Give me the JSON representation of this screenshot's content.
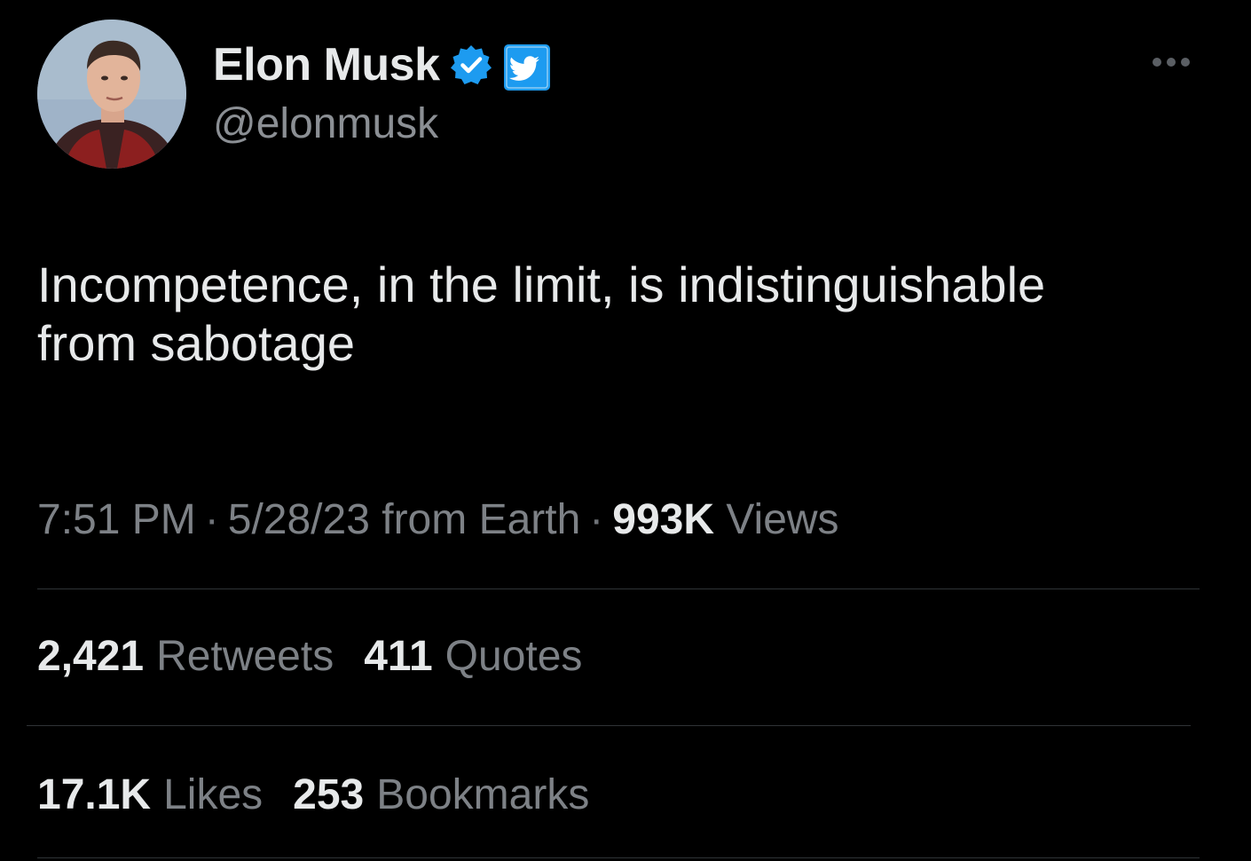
{
  "colors": {
    "background": "#000000",
    "primary_text": "#e7e9ea",
    "secondary_text": "#7d8186",
    "verified_badge": "#1d9bf0",
    "divider": "#2f3336"
  },
  "author": {
    "display_name": "Elon Musk",
    "handle": "@elonmusk",
    "avatar_icon": "profile-photo",
    "verified_icon": "verified-badge-icon",
    "platform_icon": "twitter-bird-icon"
  },
  "tweet": {
    "text": "Incompetence, in the limit, is indistinguishable\nfrom sabotage",
    "time": "7:51 PM",
    "date_source": "5/28/23 from Earth",
    "views_count": "993K",
    "views_label": "Views",
    "separator": "·"
  },
  "stats": {
    "retweets_count": "2,421",
    "retweets_label": "Retweets",
    "quotes_count": "411",
    "quotes_label": "Quotes",
    "likes_count": "17.1K",
    "likes_label": "Likes",
    "bookmarks_count": "253",
    "bookmarks_label": "Bookmarks"
  },
  "menu": {
    "more_icon": "more-options-icon"
  }
}
